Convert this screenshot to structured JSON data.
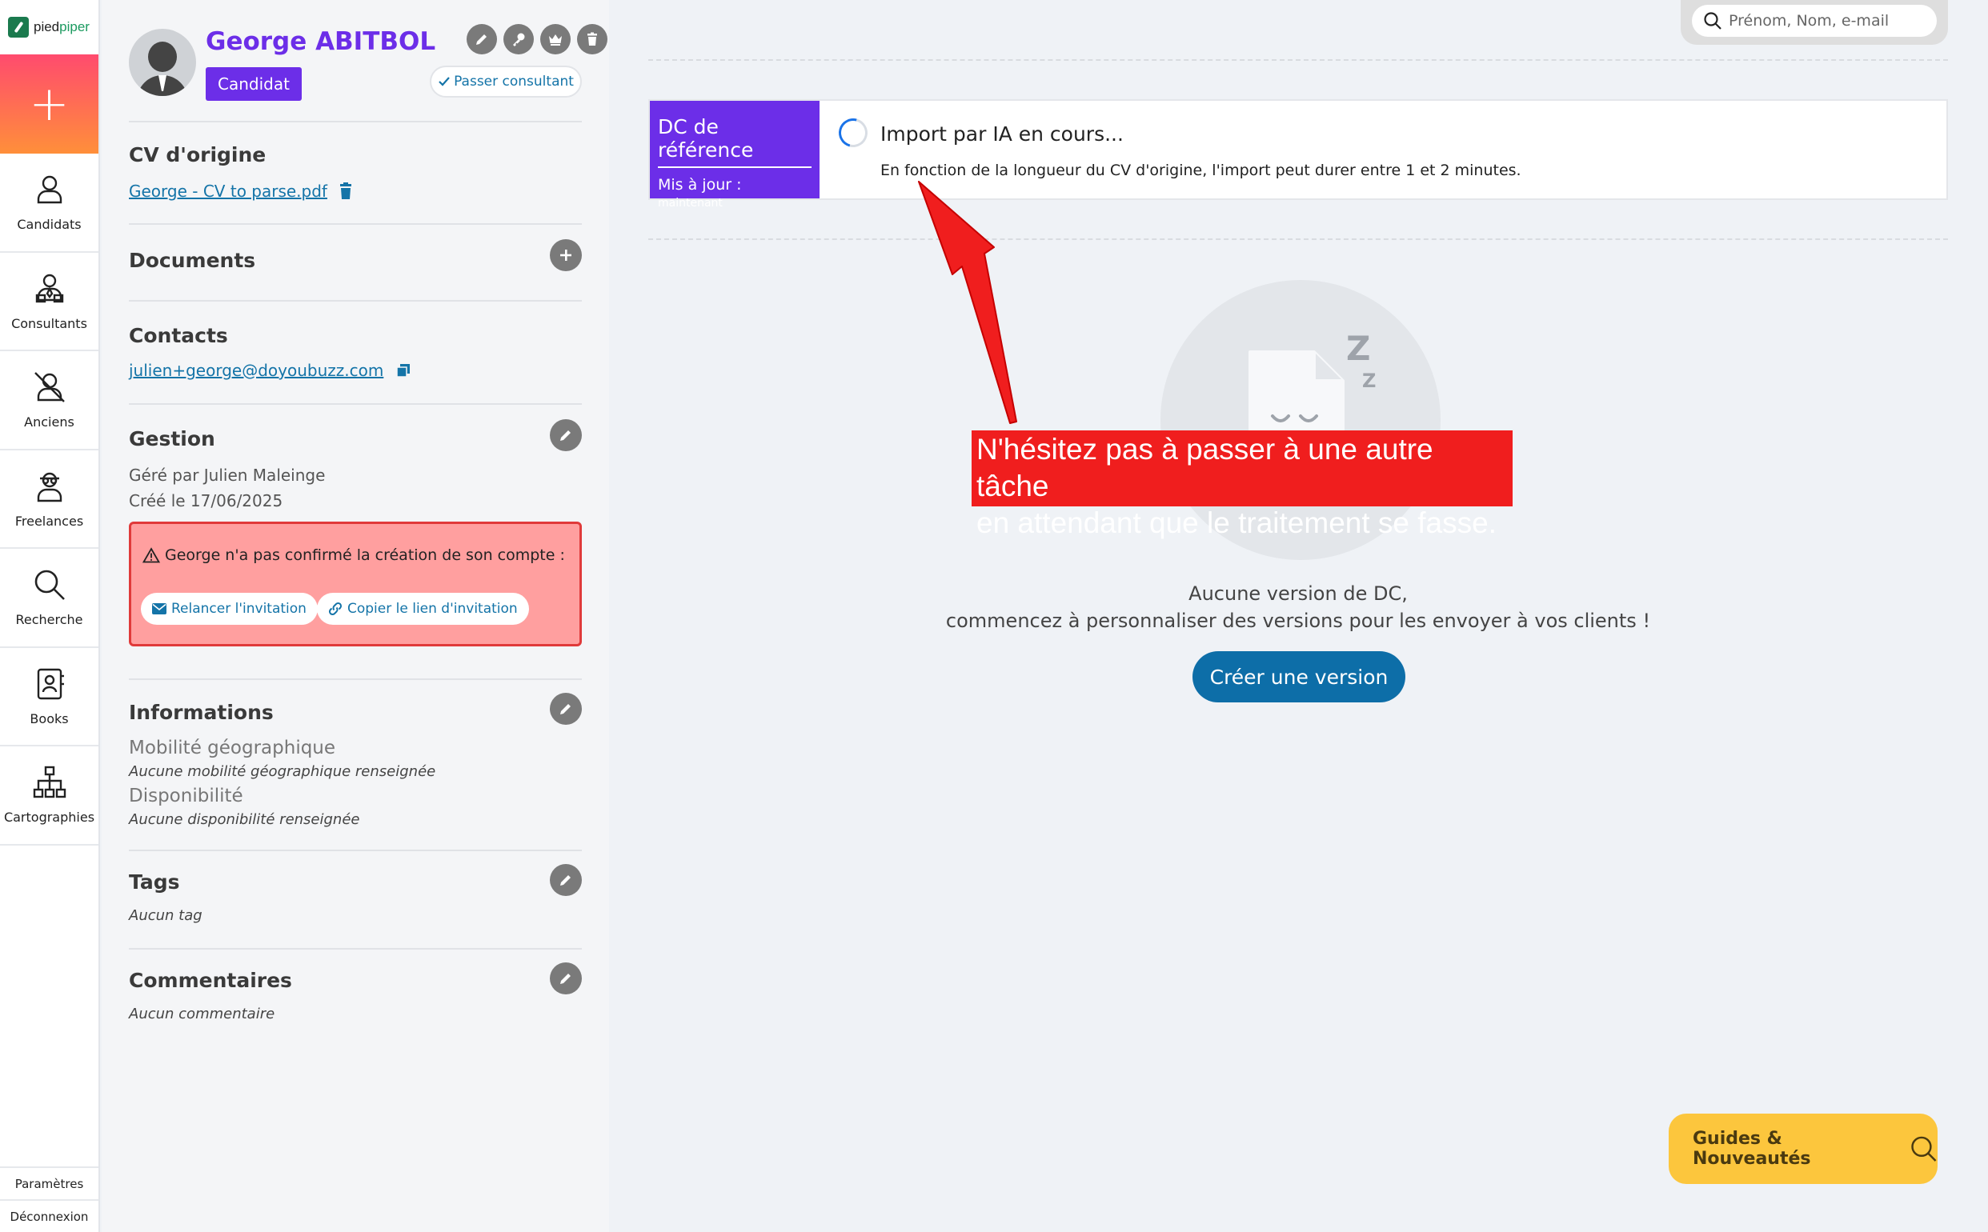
{
  "logo": {
    "part1": "pied",
    "part2": "piper"
  },
  "nav": {
    "add_label": "+",
    "items": [
      {
        "label": "Candidats",
        "icon": "user-icon"
      },
      {
        "label": "Consultants",
        "icon": "consultant-icon"
      },
      {
        "label": "Anciens",
        "icon": "former-user-icon"
      },
      {
        "label": "Freelances",
        "icon": "freelance-icon"
      },
      {
        "label": "Recherche",
        "icon": "search-icon"
      },
      {
        "label": "Books",
        "icon": "book-icon"
      },
      {
        "label": "Cartographies",
        "icon": "org-chart-icon"
      }
    ],
    "settings": "Paramètres",
    "logout": "Déconnexion"
  },
  "profile": {
    "name": "George ABITBOL",
    "badge": "Candidat",
    "switch_label": "Passer consultant",
    "cv": {
      "title": "CV d'origine",
      "file": "George - CV to parse.pdf"
    },
    "documents": {
      "title": "Documents"
    },
    "contacts": {
      "title": "Contacts",
      "email": "julien+george@doyoubuzz.com"
    },
    "gestion": {
      "title": "Gestion",
      "managed_by": "Géré par Julien Maleinge",
      "created": "Créé le 17/06/2025",
      "alert": "George n'a pas confirmé la création de son compte :",
      "resend": "Relancer l'invitation",
      "copy_link": "Copier le lien d'invitation"
    },
    "informations": {
      "title": "Informations",
      "mobility_label": "Mobilité géographique",
      "mobility_value": "Aucune mobilité géographique renseignée",
      "availability_label": "Disponibilité",
      "availability_value": "Aucune disponibilité renseignée"
    },
    "tags": {
      "title": "Tags",
      "value": "Aucun tag"
    },
    "comments": {
      "title": "Commentaires",
      "value": "Aucun commentaire"
    }
  },
  "search": {
    "placeholder": "Prénom, Nom, e-mail"
  },
  "dc": {
    "tab_title": "DC de référence",
    "updated_label": "Mis à jour :",
    "updated_value": "maintenant",
    "import_title": "Import par IA en cours...",
    "import_desc": "En fonction de la longueur du CV d'origine, l'import peut durer entre 1 et 2 minutes."
  },
  "empty": {
    "line1": "Aucune version de DC,",
    "line2": "commencez à personnaliser des versions pour les envoyer à vos clients !",
    "create_btn": "Créer une version",
    "zz": "Z",
    "z": "Z"
  },
  "annotation": {
    "line1": "N'hésitez pas à passer à une autre tâche",
    "line2": "en attendant que le traitement se fasse."
  },
  "guides": {
    "label": "Guides & Nouveautés"
  },
  "colors": {
    "accent": "#6c2ee8",
    "link": "#1474a8",
    "primary_button": "#0d6ea8",
    "alert_bg": "#ff9f9f",
    "annotation": "#f01e1e",
    "guides": "#fcc63d"
  }
}
